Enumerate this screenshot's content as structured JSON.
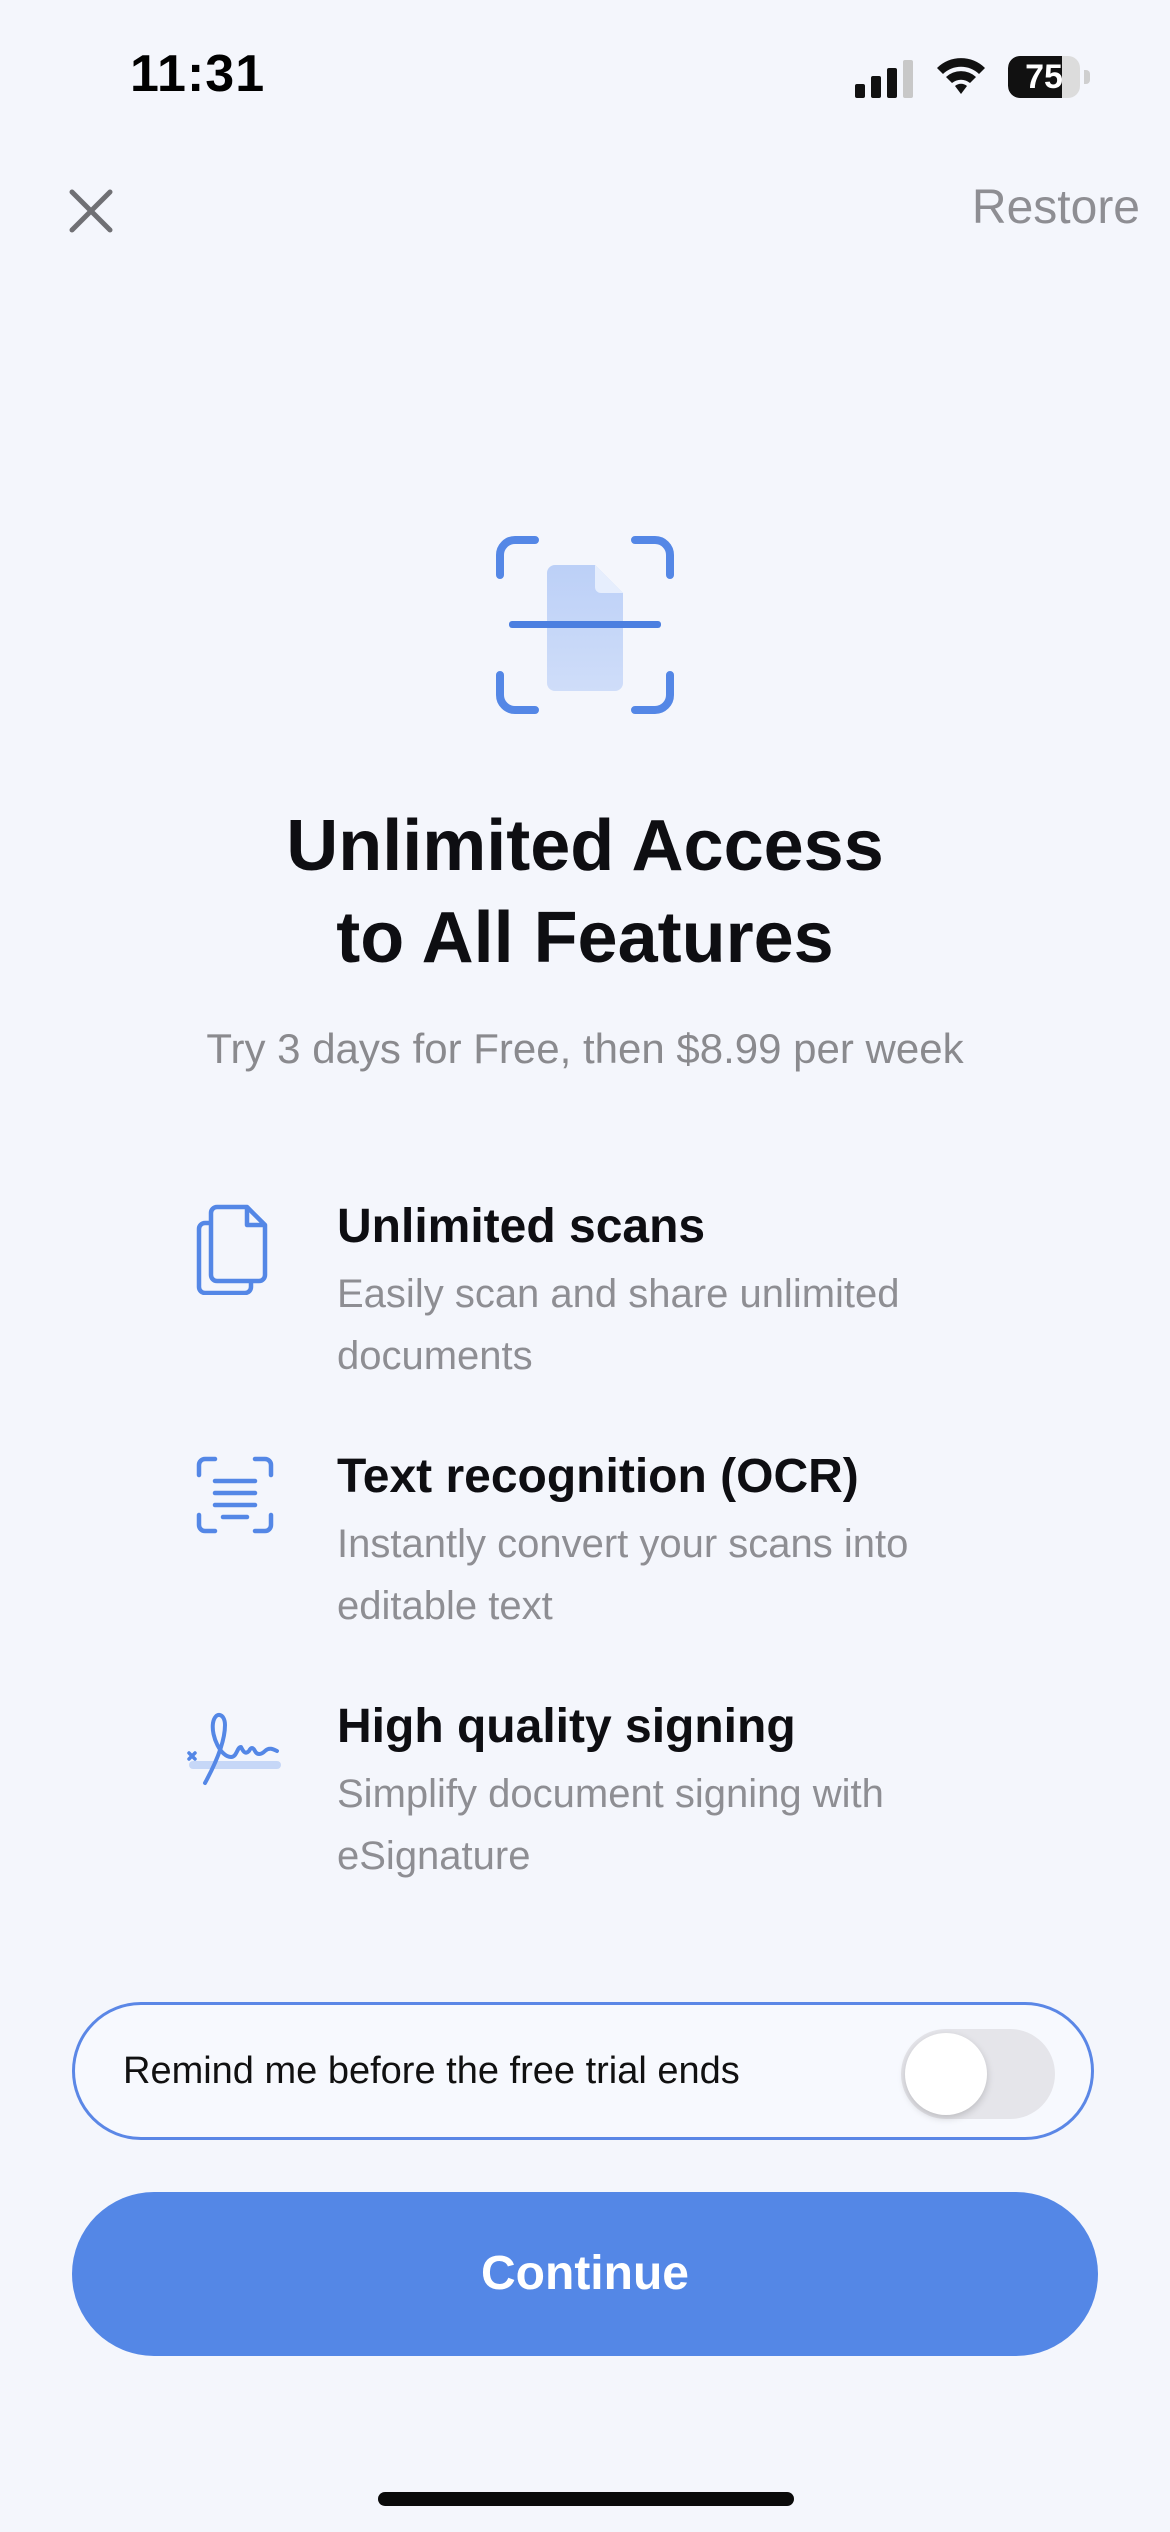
{
  "status_bar": {
    "time": "11:31",
    "battery_percent": "75",
    "battery_level": 0.75,
    "icons": [
      "signal-icon",
      "wifi-icon",
      "battery-icon"
    ]
  },
  "nav": {
    "close_icon": "close-icon",
    "restore_label": "Restore"
  },
  "hero": {
    "icon": "document-scan-icon",
    "title_line1": "Unlimited Access",
    "title_line2": "to All Features",
    "subtitle": "Try 3 days for Free, then $8.99 per week"
  },
  "features": [
    {
      "icon": "documents-icon",
      "title": "Unlimited scans",
      "desc": "Easily scan and share unlimited documents"
    },
    {
      "icon": "text-scan-icon",
      "title": "Text recognition (OCR)",
      "desc": "Instantly convert your scans into editable text"
    },
    {
      "icon": "signature-icon",
      "title": "High quality signing",
      "desc": "Simplify document signing with eSignature"
    }
  ],
  "reminder": {
    "label": "Remind me before the free trial ends",
    "enabled": false
  },
  "continue_label": "Continue",
  "colors": {
    "accent": "#5487E6",
    "background": "#F4F6FC",
    "muted_text": "#8E8E93"
  }
}
